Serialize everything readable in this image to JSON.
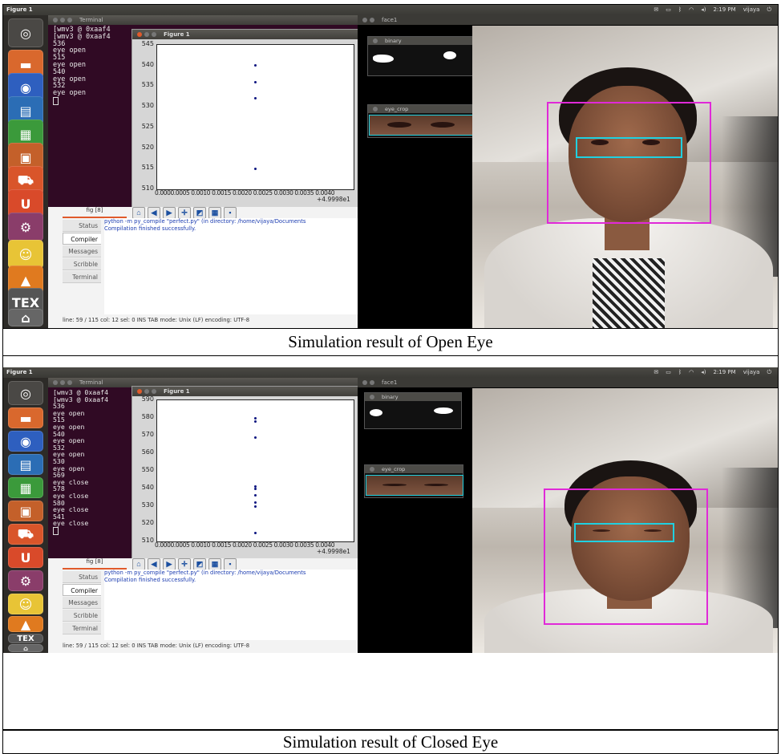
{
  "panels": [
    {
      "id": "open",
      "caption": "Simulation result of Open Eye",
      "topbar": {
        "title": "Figure 1",
        "time": "2:19 PM",
        "user": "vijaya"
      },
      "terminal": {
        "title": "Terminal",
        "lines": [
          "[wmv3 @ 0xaaf4",
          "[wmv3 @ 0xaaf4",
          "536",
          "eye open",
          "515",
          "eye open",
          "540",
          "eye open",
          "532",
          "eye open"
        ]
      },
      "figure": {
        "title": "Figure 1"
      },
      "chart_data": {
        "type": "scatter",
        "title": "",
        "xlabel": "",
        "ylabel": "",
        "y_ticks": [
          "545",
          "540",
          "535",
          "530",
          "525",
          "520",
          "515",
          "510"
        ],
        "ylim": [
          510,
          545
        ],
        "x_ticks_label": "0.0000.0005 0.0010 0.0015 0.0020 0.0025 0.0030 0.0035 0.0040",
        "x_offset": "+4.9998e1",
        "xlim": [
          0.0,
          0.004
        ],
        "x": [
          0.002,
          0.002,
          0.002,
          0.002
        ],
        "y": [
          540,
          536,
          532,
          515
        ]
      },
      "geany": {
        "tab": "fig [8]",
        "sidebar": [
          "Status",
          "Compiler",
          "Messages",
          "Scribble",
          "Terminal"
        ],
        "active": "Compiler",
        "output": [
          "python -m py_compile \"perfect.py\" (in directory: /home/vijaya/Documents",
          "Compilation finished successfully."
        ],
        "status": "line: 59 / 115   col: 12    sel: 0   INS   TAB   mode: Unix (LF)   encoding: UTF-8"
      },
      "face_window": {
        "title": "face1",
        "binary_title": "binary",
        "eyecrop_title": "eye_crop"
      }
    },
    {
      "id": "closed",
      "caption": "Simulation result of Closed Eye",
      "topbar": {
        "title": "Figure 1",
        "time": "2:19 PM",
        "user": "vijaya"
      },
      "terminal": {
        "title": "Terminal",
        "lines": [
          "[wmv3 @ 0xaaf4",
          "[wmv3 @ 0xaaf4",
          "536",
          "eye open",
          "515",
          "eye open",
          "540",
          "eye open",
          "532",
          "eye open",
          "530",
          "eye open",
          "569",
          "eye close",
          "578",
          "eye close",
          "580",
          "eye close",
          "541",
          "eye close"
        ]
      },
      "figure": {
        "title": "Figure 1"
      },
      "chart_data": {
        "type": "scatter",
        "title": "",
        "xlabel": "",
        "ylabel": "",
        "y_ticks": [
          "590",
          "580",
          "570",
          "560",
          "550",
          "540",
          "530",
          "520",
          "510"
        ],
        "ylim": [
          510,
          590
        ],
        "x_ticks_label": "0.0000.0005 0.0010 0.0015 0.0020 0.0025 0.0030 0.0035 0.0040",
        "x_offset": "+4.9998e1",
        "xlim": [
          0.0,
          0.004
        ],
        "x": [
          0.002,
          0.002,
          0.002,
          0.002,
          0.002,
          0.002,
          0.002,
          0.002,
          0.002
        ],
        "y": [
          580,
          578,
          569,
          541,
          540,
          536,
          532,
          530,
          515
        ]
      },
      "geany": {
        "tab": "fig [8]",
        "sidebar": [
          "Status",
          "Compiler",
          "Messages",
          "Scribble",
          "Terminal"
        ],
        "active": "Compiler",
        "output": [
          "python -m py_compile \"perfect.py\" (in directory: /home/vijaya/Documents",
          "Compilation finished successfully."
        ],
        "status": "line: 59 / 115   col: 12    sel: 0   INS   TAB   mode: Unix (LF)   encoding: UTF-8"
      },
      "face_window": {
        "title": "face1",
        "binary_title": "binary",
        "eyecrop_title": "eye_crop"
      }
    }
  ],
  "launcher_icons": [
    "dash-icon",
    "files-icon",
    "firefox-icon",
    "writer-icon",
    "calc-icon",
    "impress-icon",
    "software-center-icon",
    "ubuntu-one-icon",
    "settings-icon",
    "geany-icon",
    "vlc-icon",
    "tex-icon",
    "trash-icon"
  ],
  "launcher_label": "TEX",
  "colors": {
    "face_box": "#e029d8",
    "eye_box": "#20d0e0",
    "terminal_bg": "#300a24",
    "point": "#0b1580"
  }
}
